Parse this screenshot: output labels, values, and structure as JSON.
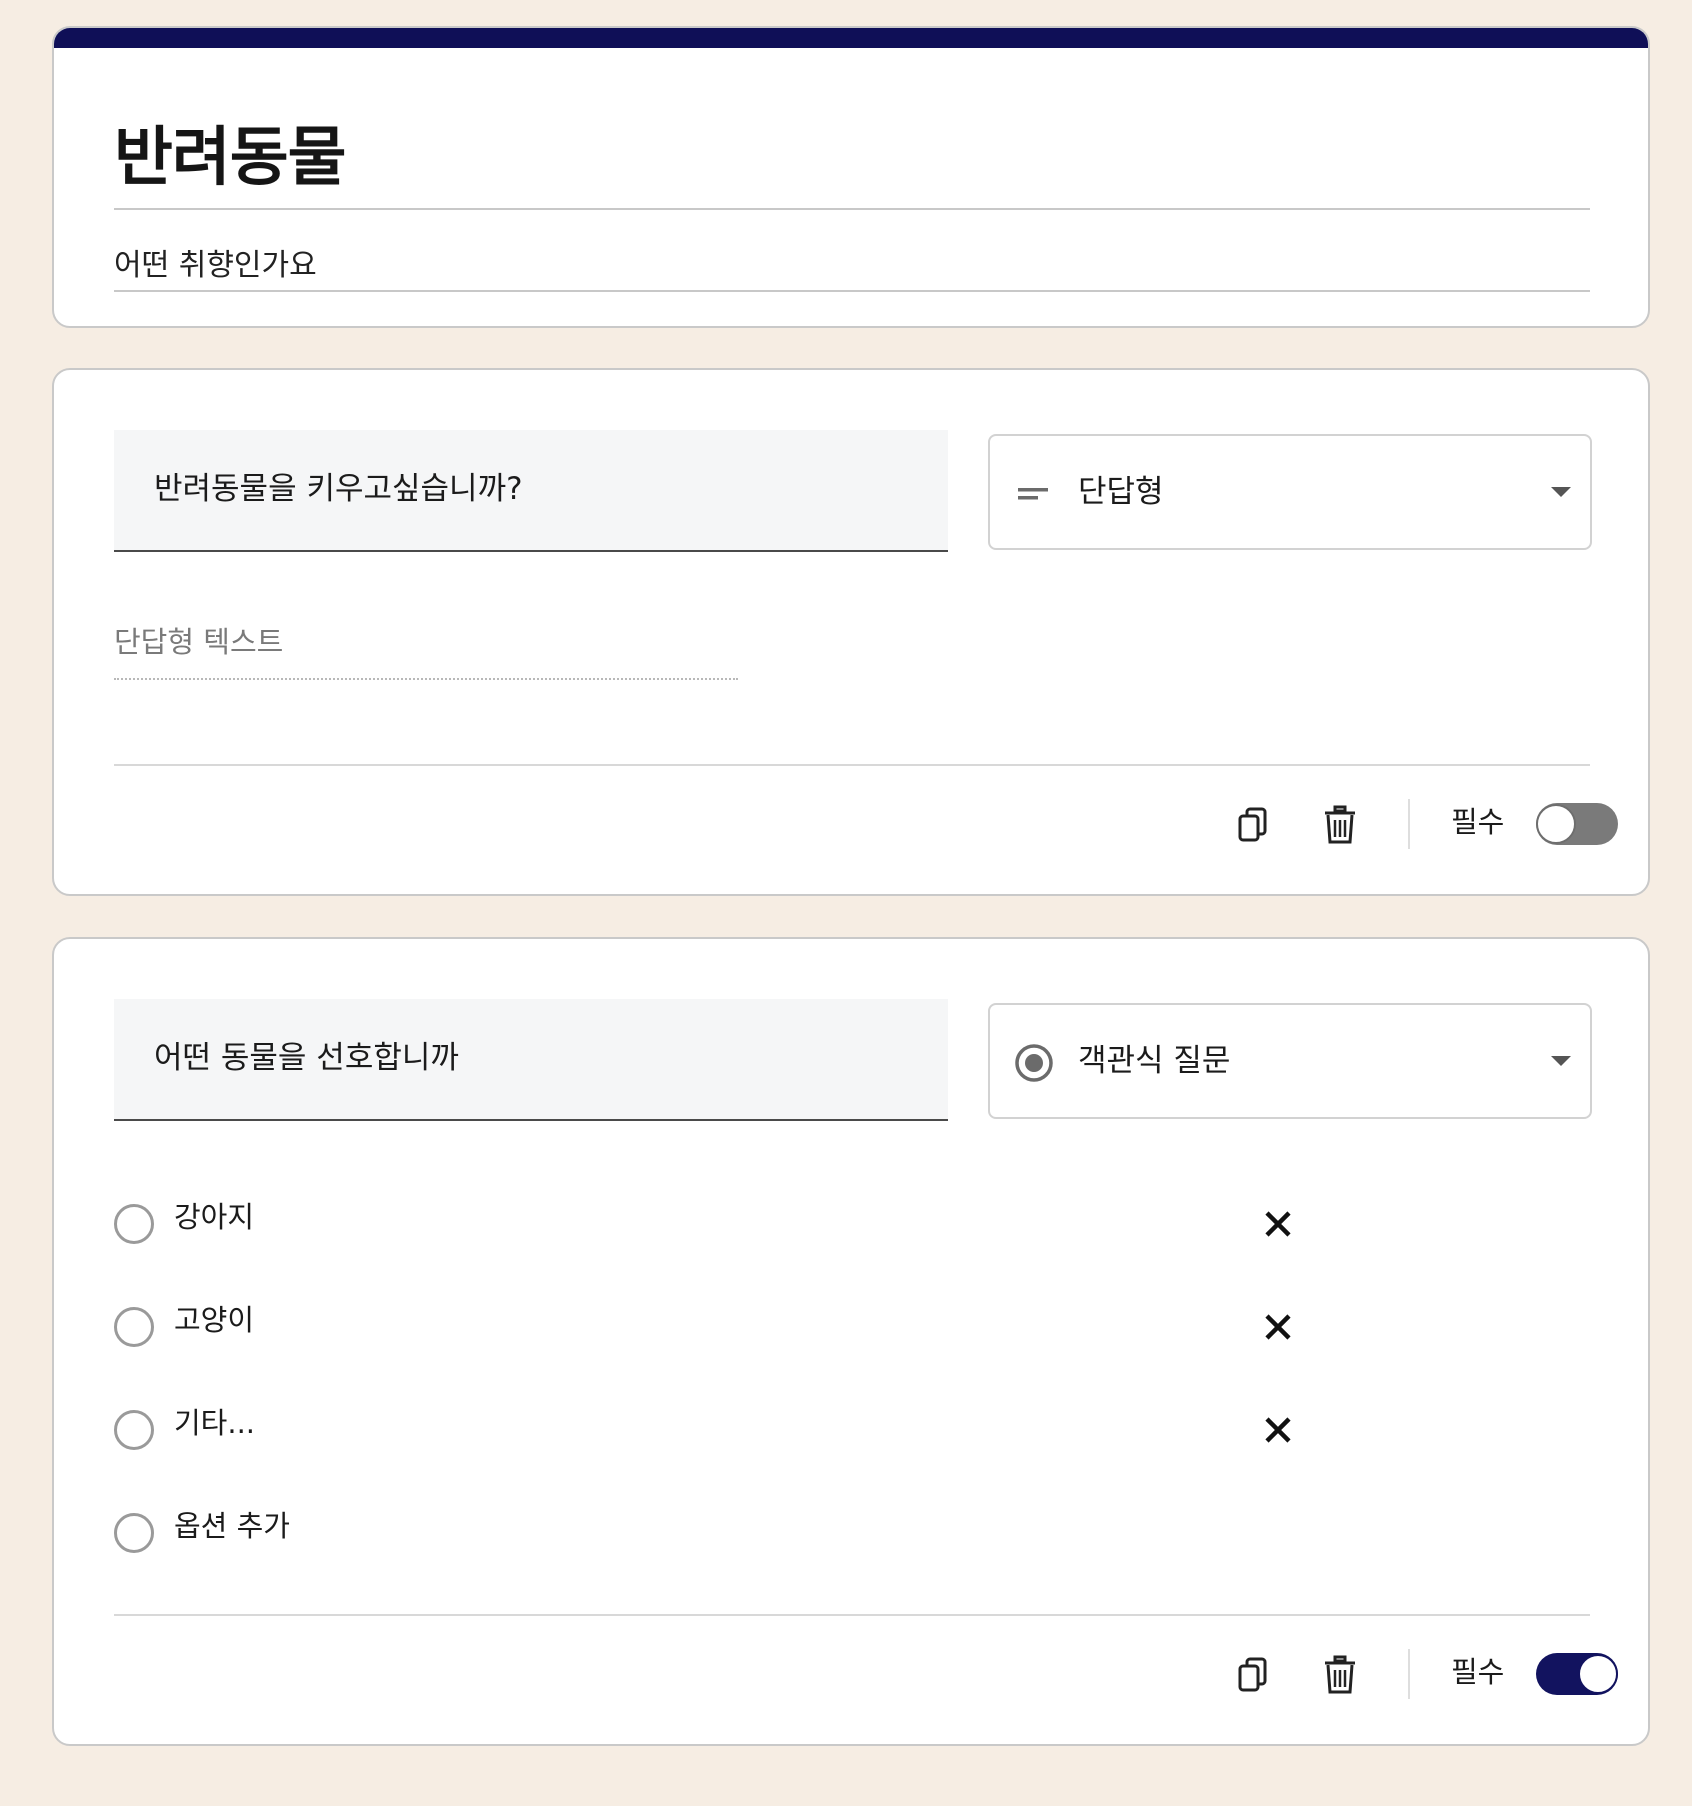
{
  "header": {
    "title": "반려동물",
    "description": "어떤 취향인가요"
  },
  "questions": [
    {
      "title": "반려동물을 키우고싶습니까?",
      "type_label": "단답형",
      "type_icon": "short-answer-icon",
      "answer_placeholder": "단답형 텍스트",
      "required_label": "필수",
      "required": false
    },
    {
      "title": "어떤 동물을 선호합니까",
      "type_label": "객관식 질문",
      "type_icon": "radio-button-icon",
      "options": [
        "강아지",
        "고양이",
        "기타..."
      ],
      "add_option_label": "옵션 추가",
      "required_label": "필수",
      "required": true
    }
  ],
  "colors": {
    "page_background": "#f6ede3",
    "accent": "#0f0f57",
    "toggle_on": "#12135f",
    "toggle_off": "#7a7a7a"
  }
}
